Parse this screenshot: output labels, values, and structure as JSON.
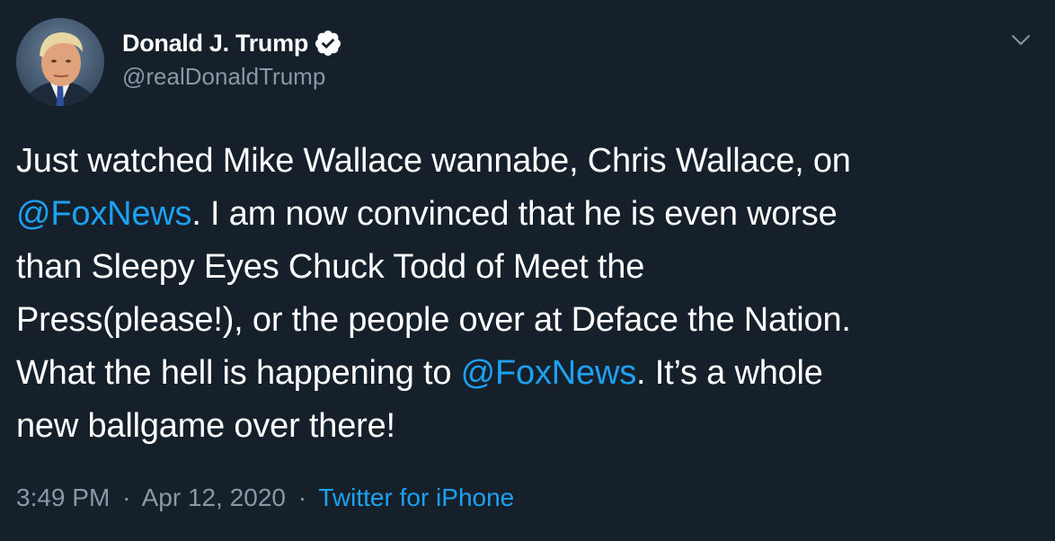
{
  "author": {
    "display_name": "Donald J. Trump",
    "handle": "@realDonaldTrump",
    "verified": true,
    "avatar_icon": "profile-photo"
  },
  "tweet": {
    "lines": [
      {
        "segments": [
          {
            "text": "Just watched Mike Wallace wannabe, Chris Wallace, on",
            "mention": false
          }
        ]
      },
      {
        "segments": [
          {
            "text": "@FoxNews",
            "mention": true
          },
          {
            "text": ". I am now convinced that he is even worse",
            "mention": false
          }
        ]
      },
      {
        "segments": [
          {
            "text": "than Sleepy Eyes Chuck Todd of Meet the",
            "mention": false
          }
        ]
      },
      {
        "segments": [
          {
            "text": "Press(please!), or the people over at Deface the Nation.",
            "mention": false
          }
        ]
      },
      {
        "segments": [
          {
            "text": "What the hell is happening to ",
            "mention": false
          },
          {
            "text": "@FoxNews",
            "mention": true
          },
          {
            "text": ". It’s a whole",
            "mention": false
          }
        ]
      },
      {
        "segments": [
          {
            "text": "new ballgame over there!",
            "mention": false
          }
        ]
      }
    ]
  },
  "meta": {
    "time": "3:49 PM",
    "separator": "·",
    "date": "Apr 12, 2020",
    "source": "Twitter for iPhone"
  },
  "colors": {
    "background": "#15202b",
    "text": "#ffffff",
    "secondary": "#8899a6",
    "link": "#1da1f2"
  },
  "icons": {
    "verified": "verified-badge-icon",
    "menu": "chevron-down-icon"
  }
}
